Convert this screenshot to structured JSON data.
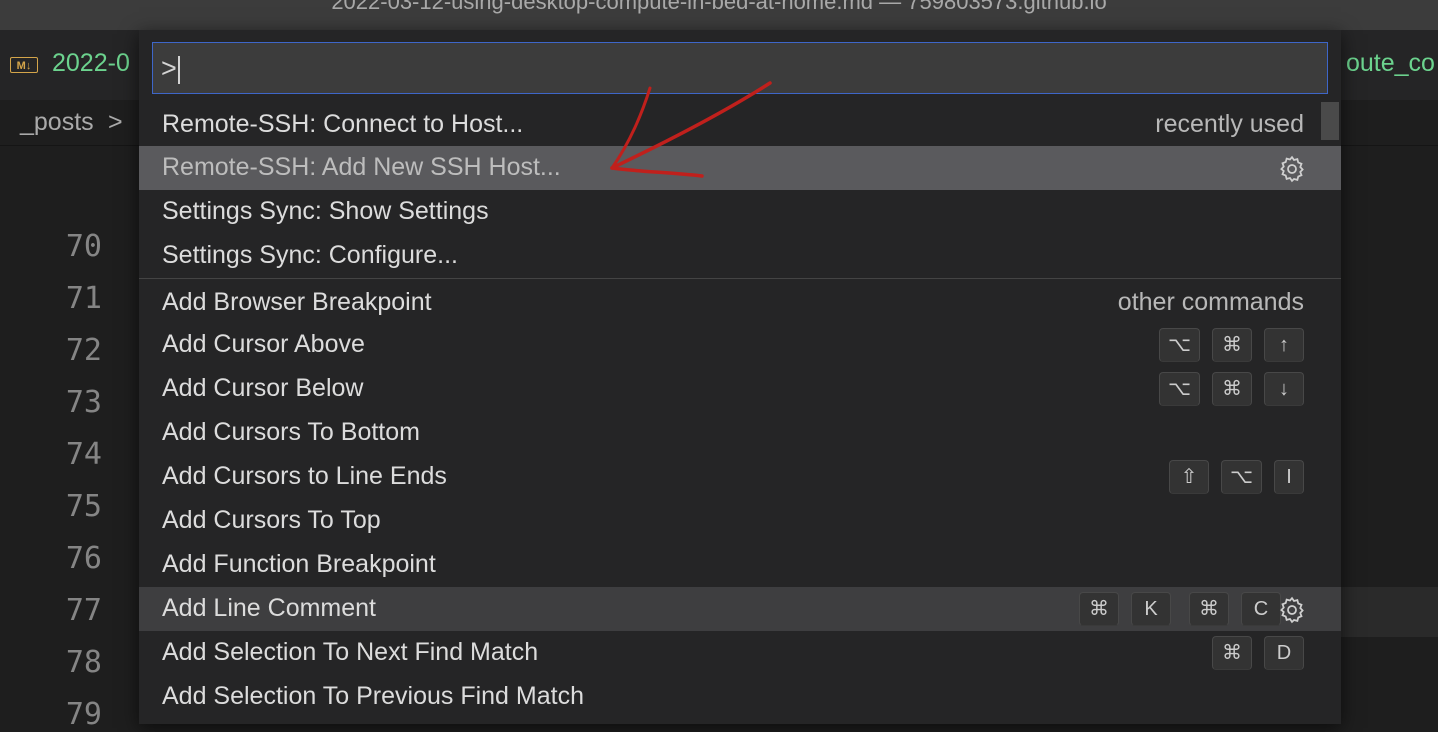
{
  "window": {
    "title": "2022-03-12-using-desktop-compute-in-bed-at-home.md — 759803573.github.io"
  },
  "tab": {
    "icon_text": "M↓",
    "label_left": "2022-0",
    "label_right": "oute_co"
  },
  "breadcrumb": {
    "folder": "_posts",
    "separator": ">"
  },
  "gutter": {
    "line_numbers": [
      "70",
      "71",
      "72",
      "73",
      "74",
      "75",
      "76",
      "77",
      "78",
      "79"
    ]
  },
  "palette": {
    "input_value": ">",
    "recent_group_label": "recently used",
    "other_group_label": "other commands",
    "recent": [
      {
        "label": "Remote-SSH: Connect to Host..."
      },
      {
        "label": "Remote-SSH: Add New SSH Host...",
        "selected": true
      },
      {
        "label": "Settings Sync: Show Settings"
      },
      {
        "label": "Settings Sync: Configure..."
      }
    ],
    "commands": [
      {
        "label": "Add Browser Breakpoint",
        "keys": []
      },
      {
        "label": "Add Cursor Above",
        "keys": [
          [
            "⌥",
            "⌘",
            "↑"
          ]
        ]
      },
      {
        "label": "Add Cursor Below",
        "keys": [
          [
            "⌥",
            "⌘",
            "↓"
          ]
        ]
      },
      {
        "label": "Add Cursors To Bottom",
        "keys": []
      },
      {
        "label": "Add Cursors to Line Ends",
        "keys": [
          [
            "⇧",
            "⌥",
            "I"
          ]
        ]
      },
      {
        "label": "Add Cursors To Top",
        "keys": []
      },
      {
        "label": "Add Function Breakpoint",
        "keys": []
      },
      {
        "label": "Add Line Comment",
        "keys": [
          [
            "⌘",
            "K"
          ],
          [
            "⌘",
            "C"
          ]
        ],
        "hover": true
      },
      {
        "label": "Add Selection To Next Find Match",
        "keys": [
          [
            "⌘",
            "D"
          ]
        ]
      },
      {
        "label": "Add Selection To Previous Find Match",
        "keys": []
      }
    ]
  },
  "icons": {
    "gear": "gear-icon",
    "markdown": "markdown-icon",
    "annotation_arrow": "red-arrow-annotation"
  },
  "colors": {
    "accent_border": "#3e66c8",
    "tab_label": "#6cd38e",
    "annotation_red": "#c0201c",
    "selected_row": "#5a5a5d"
  }
}
